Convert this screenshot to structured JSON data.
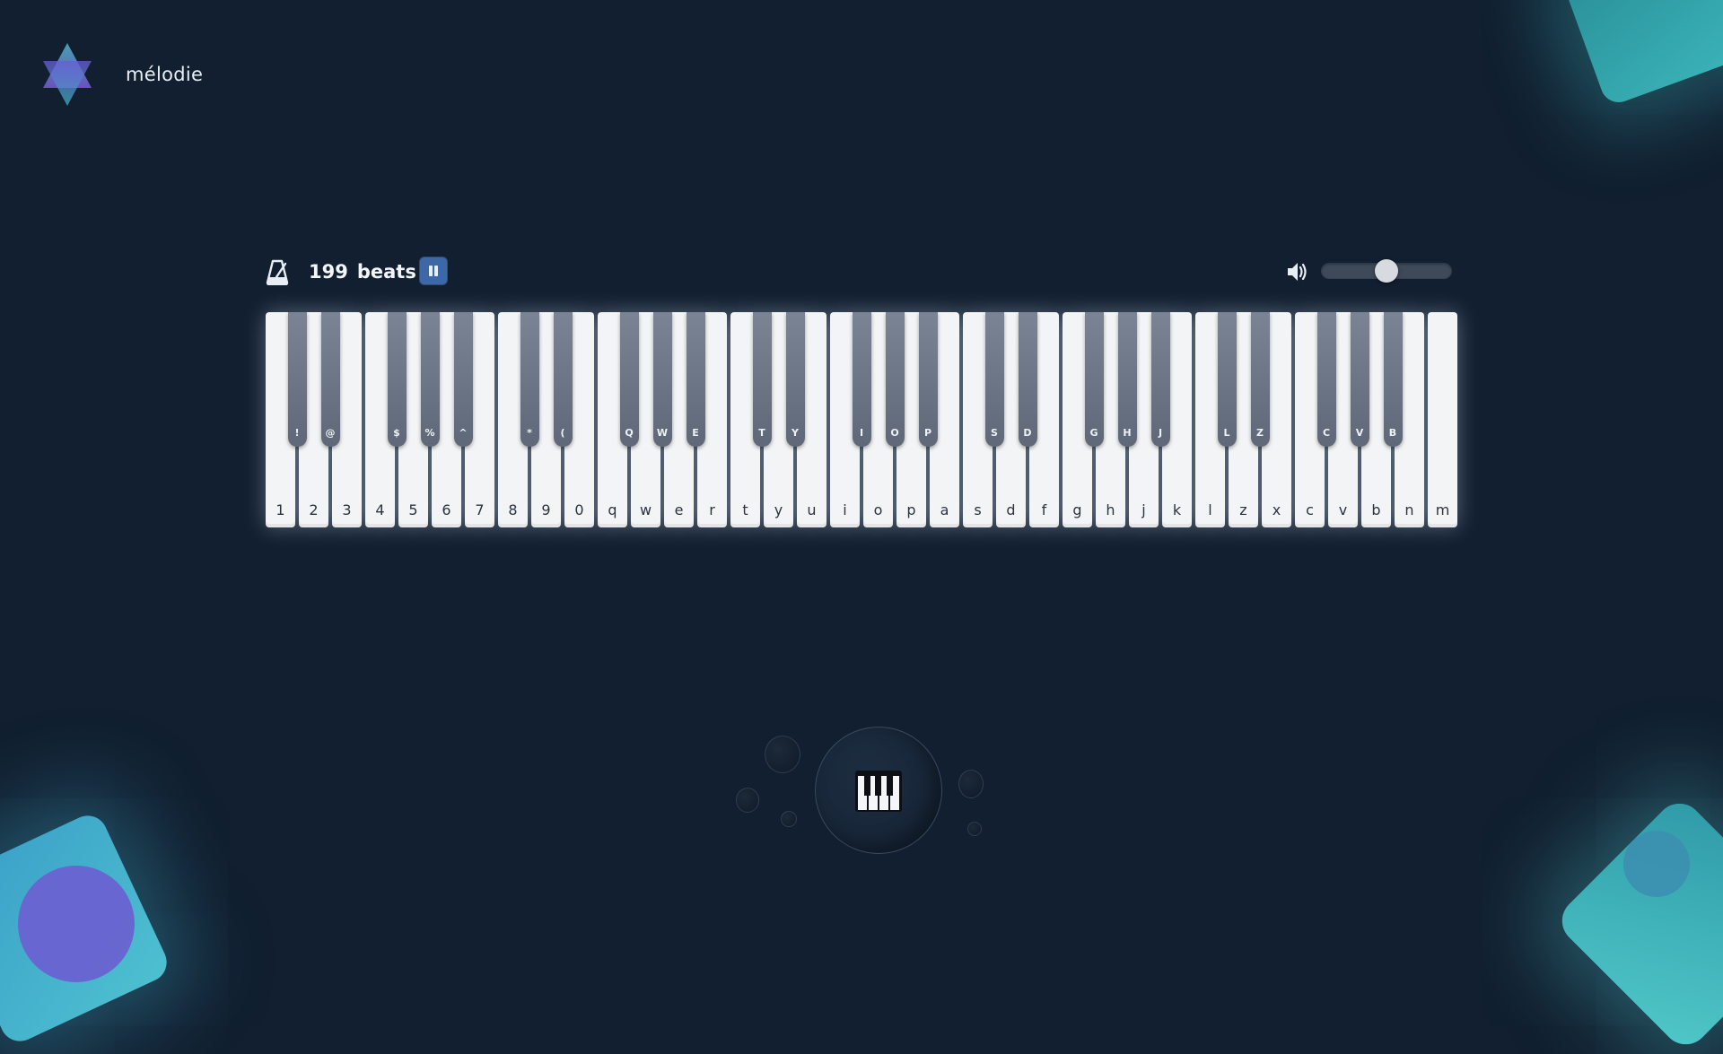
{
  "app": {
    "name": "mélodie"
  },
  "controls": {
    "beats_value": "199",
    "beats_unit": "beats",
    "volume_level": 0.5
  },
  "keyboard": {
    "white_keys": [
      "1",
      "2",
      "3",
      "4",
      "5",
      "6",
      "7",
      "8",
      "9",
      "0",
      "q",
      "w",
      "e",
      "r",
      "t",
      "y",
      "u",
      "i",
      "o",
      "p",
      "a",
      "s",
      "d",
      "f",
      "g",
      "h",
      "j",
      "k",
      "l",
      "z",
      "x",
      "c",
      "v",
      "b",
      "n",
      "m"
    ],
    "black_keys": [
      {
        "label": "!",
        "after": 0
      },
      {
        "label": "@",
        "after": 1
      },
      {
        "label": "$",
        "after": 3
      },
      {
        "label": "%",
        "after": 4
      },
      {
        "label": "^",
        "after": 5
      },
      {
        "label": "*",
        "after": 7
      },
      {
        "label": "(",
        "after": 8
      },
      {
        "label": "Q",
        "after": 10
      },
      {
        "label": "W",
        "after": 11
      },
      {
        "label": "E",
        "after": 12
      },
      {
        "label": "T",
        "after": 14
      },
      {
        "label": "Y",
        "after": 15
      },
      {
        "label": "I",
        "after": 17
      },
      {
        "label": "O",
        "after": 18
      },
      {
        "label": "P",
        "after": 19
      },
      {
        "label": "S",
        "after": 21
      },
      {
        "label": "D",
        "after": 22
      },
      {
        "label": "G",
        "after": 24
      },
      {
        "label": "H",
        "after": 25
      },
      {
        "label": "J",
        "after": 26
      },
      {
        "label": "L",
        "after": 28
      },
      {
        "label": "Z",
        "after": 29
      },
      {
        "label": "C",
        "after": 31
      },
      {
        "label": "V",
        "after": 32
      },
      {
        "label": "B",
        "after": 33
      }
    ]
  },
  "icons": {
    "logo": "star-of-david-logo",
    "metronome": "metronome-icon",
    "pause": "pause-icon",
    "volume": "volume-icon",
    "piano": "piano-icon"
  },
  "colors": {
    "background": "#111f30",
    "accent": "#3c68a8",
    "white_key": "#f3f4f6",
    "black_key": "#6b7484"
  }
}
